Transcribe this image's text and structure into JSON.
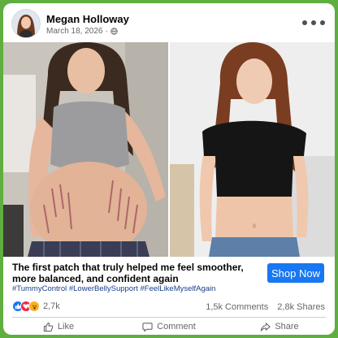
{
  "post": {
    "author": "Megan Holloway",
    "date": "March 18, 2026",
    "dot": "·",
    "privacy_icon": "globe-icon"
  },
  "ad": {
    "headline": "The first patch that truly helped me feel smoother, more balanced, and confident again",
    "hashtags": "#TummyControl #LowerBellySupport #FeelLikeMyselfAgain",
    "cta_label": "Shop Now"
  },
  "stats": {
    "reactions": [
      "like-icon",
      "love-icon",
      "wow-icon"
    ],
    "reaction_count": "2,7k",
    "comments": "1,5k Comments",
    "shares": "2,8k Shares"
  },
  "actions": {
    "like": "Like",
    "comment": "Comment",
    "share": "Share"
  },
  "colors": {
    "frame": "#5fae3f",
    "cta": "#1877f2",
    "hashtag": "#1a3f8a"
  }
}
